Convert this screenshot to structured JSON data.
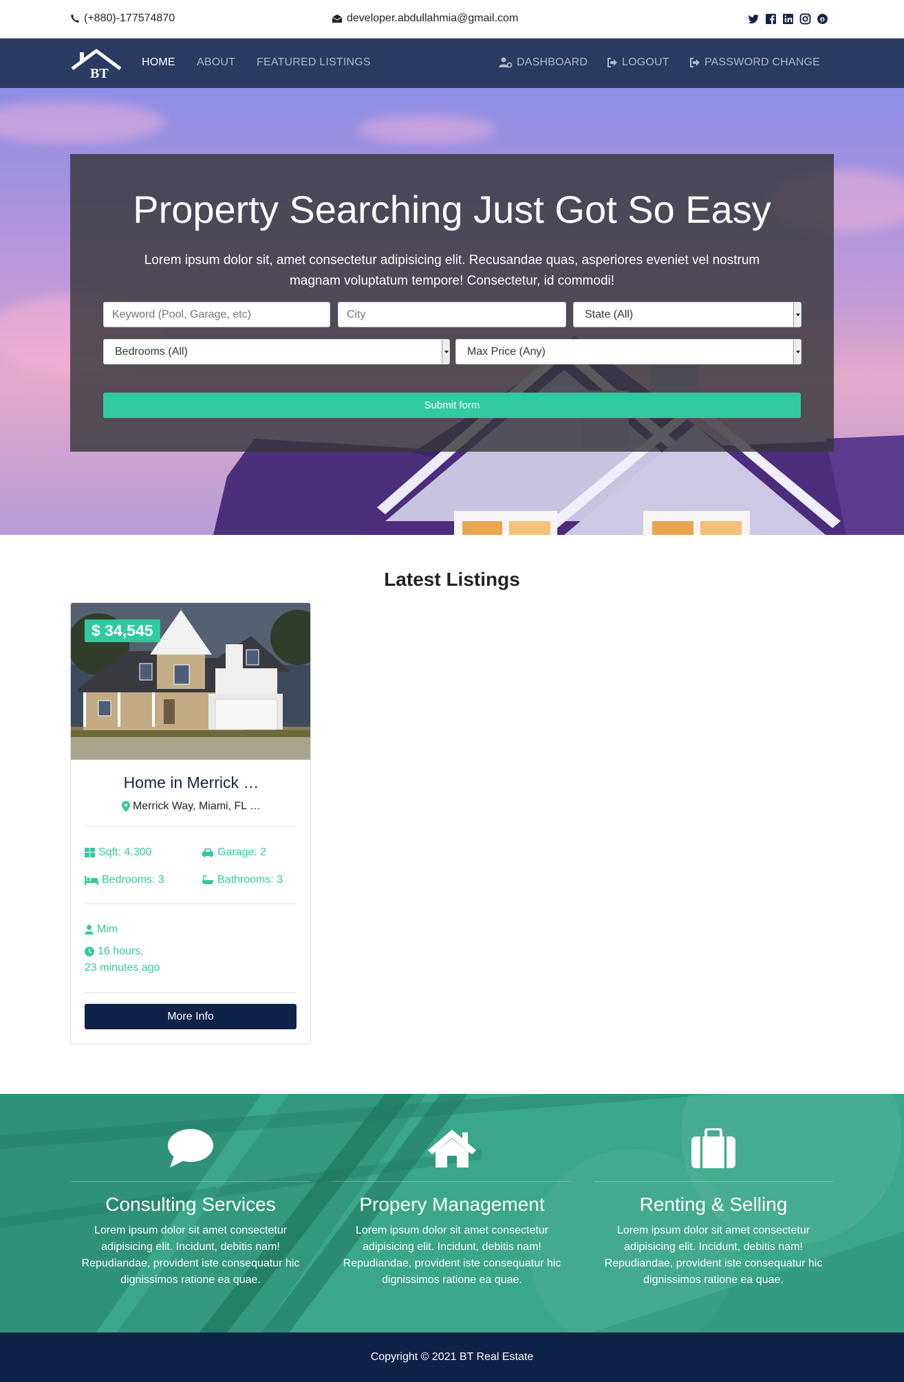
{
  "topbar": {
    "phone": "(+880)-177574870",
    "email": "developer.abdullahmia@gmail.com",
    "socials": [
      "twitter-icon",
      "facebook-icon",
      "linkedin-icon",
      "instagram-icon",
      "pinterest-icon"
    ]
  },
  "nav": {
    "logo_text": "BT",
    "home": "HOME",
    "about": "ABOUT",
    "featured": "FEATURED LISTINGS",
    "dashboard": "DASHBOARD",
    "logout": "LOGOUT",
    "password_change": "PASSWORD CHANGE"
  },
  "hero": {
    "title": "Property Searching Just Got So Easy",
    "text": "Lorem ipsum dolor sit, amet consectetur adipisicing elit. Recusandae quas, asperiores eveniet vel nostrum magnam voluptatum tempore! Consectetur, id commodi!",
    "keyword_placeholder": "Keyword (Pool, Garage, etc)",
    "city_placeholder": "City",
    "state_selected": "State (All)",
    "bedrooms_selected": "Bedrooms (All)",
    "price_selected": "Max Price (Any)",
    "submit_label": "Submit form"
  },
  "listings": {
    "title": "Latest Listings",
    "items": [
      {
        "price": "$ 34,545",
        "title": "Home in Merrick …",
        "address": "Merrick Way, Miami, FL …",
        "sqft": "Sqft: 4,300",
        "garage": "Garage: 2",
        "bedrooms": "Bedrooms: 3",
        "bathrooms": "Bathrooms: 3",
        "realtor": "Mim",
        "time_line1": "16 hours,",
        "time_line2": "23 minutes ago",
        "button": "More Info"
      }
    ]
  },
  "services": [
    {
      "icon": "comment-icon",
      "title": "Consulting Services",
      "text": "Lorem ipsum dolor sit amet consectetur adipisicing elit. Incidunt, debitis nam! Repudiandae, provident iste consequatur hic dignissimos ratione ea quae."
    },
    {
      "icon": "home-icon",
      "title": "Propery Management",
      "text": "Lorem ipsum dolor sit amet consectetur adipisicing elit. Incidunt, debitis nam! Repudiandae, provident iste consequatur hic dignissimos ratione ea quae."
    },
    {
      "icon": "suitcase-icon",
      "title": "Renting & Selling",
      "text": "Lorem ipsum dolor sit amet consectetur adipisicing elit. Incidunt, debitis nam! Repudiandae, provident iste consequatur hic dignissimos ratione ea quae."
    }
  ],
  "footer": {
    "copyright": "Copyright © 2021 BT Real Estate"
  },
  "colors": {
    "navbar": "#2a3b62",
    "accent": "#30c9a0",
    "primary_dark": "#0f2248",
    "services_bg": "#2e9b80"
  }
}
